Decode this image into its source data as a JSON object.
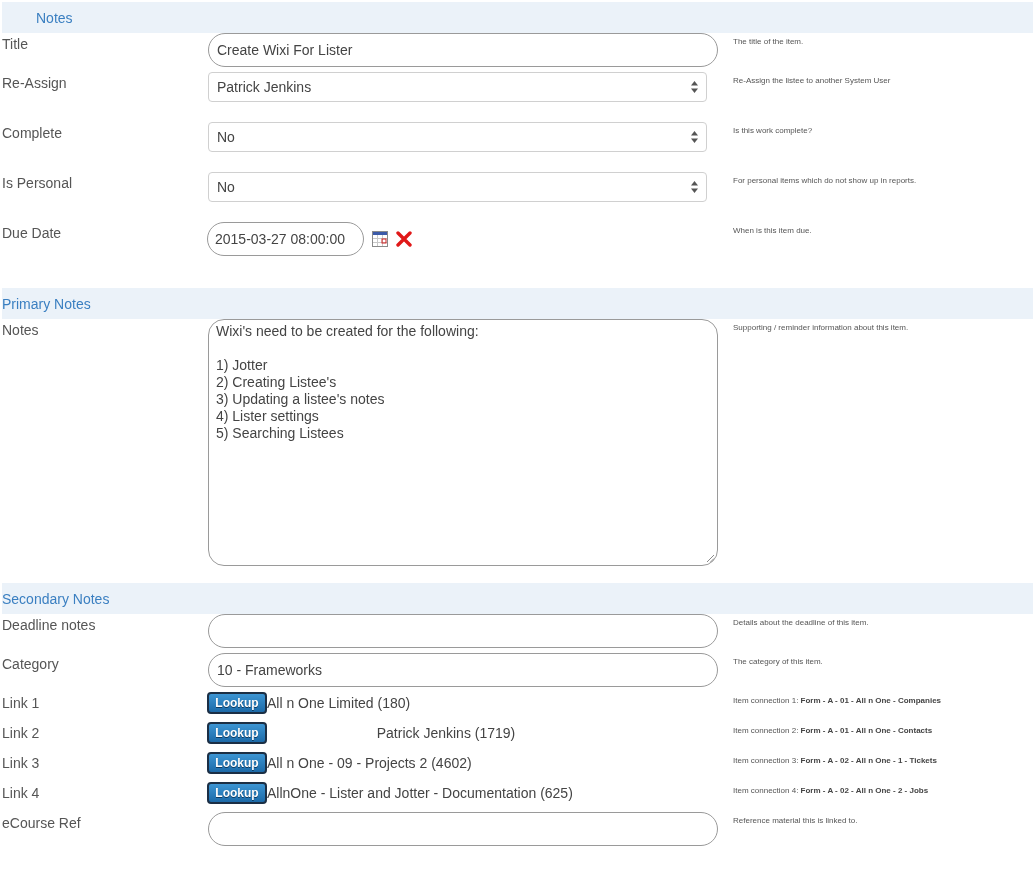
{
  "sections": [
    {
      "title": "Notes",
      "indented": true,
      "rows": [
        {
          "kind": "text",
          "label": "Title",
          "value": "Create Wixi For Lister",
          "help": "The title of the item."
        },
        {
          "kind": "select",
          "label": "Re-Assign",
          "value": "Patrick Jenkins",
          "help": "Re-Assign the listee to another System User"
        },
        {
          "kind": "select",
          "label": "Complete",
          "value": "No",
          "help": "Is this work complete?"
        },
        {
          "kind": "select",
          "label": "Is Personal",
          "value": "No",
          "help": "For personal items which do not show up in reports."
        },
        {
          "kind": "date",
          "label": "Due Date",
          "value": "2015-03-27 08:00:00",
          "help": "When is this item due."
        }
      ]
    },
    {
      "title": "Primary Notes",
      "indented": false,
      "rows": [
        {
          "kind": "textarea",
          "label": "Notes",
          "value": "Wixi's need to be created for the following:\n\n1) Jotter\n2) Creating Listee's\n3) Updating a listee's notes\n4) Lister settings\n5) Searching Listees",
          "help": "Supporting / reminder information about this item."
        }
      ]
    },
    {
      "title": "Secondary Notes",
      "indented": false,
      "rows": [
        {
          "kind": "text",
          "label": "Deadline notes",
          "help": "Details about the deadline of this item."
        },
        {
          "kind": "text",
          "label": "Category",
          "value": "10 - Frameworks",
          "help": "The category of this item."
        },
        {
          "kind": "lookup",
          "label": "Link 1",
          "button": "Lookup",
          "value": "All n One Limited (180)",
          "centered": false,
          "help": "Item connection 1: **Form - A - 01 - All n One - Companies**"
        },
        {
          "kind": "lookup",
          "label": "Link 2",
          "button": "Lookup",
          "value": "Patrick Jenkins (1719)",
          "centered": true,
          "help": "Item connection 2: **Form - A - 01 - All n One - Contacts**"
        },
        {
          "kind": "lookup",
          "label": "Link 3",
          "button": "Lookup",
          "value": "All n One - 09 - Projects 2 (4602)",
          "centered": false,
          "help": "Item connection 3: **Form - A - 02 - All n One - 1 - Tickets**"
        },
        {
          "kind": "lookup",
          "label": "Link 4",
          "button": "Lookup",
          "value": "AllnOne - Lister and Jotter - Documentation (625)",
          "centered": false,
          "help": "Item connection 4: **Form - A - 02 - All n One - 2 - Jobs**"
        },
        {
          "kind": "text",
          "label": "eCourse Ref",
          "help": "Reference material this is linked to."
        }
      ]
    }
  ]
}
